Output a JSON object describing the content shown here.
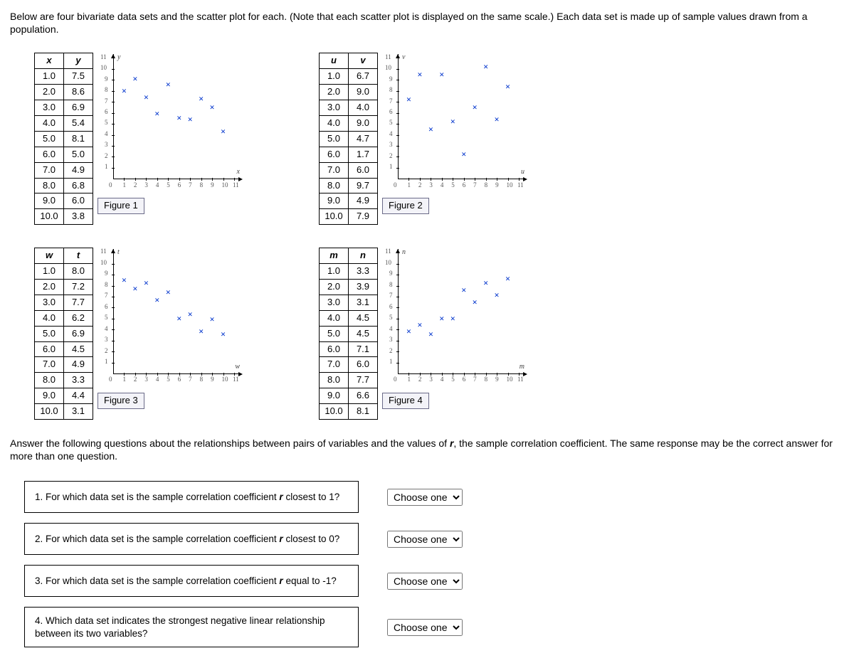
{
  "intro": "Below are four bivariate data sets and the scatter plot for each. (Note that each scatter plot is displayed on the same scale.) Each data set is made up of sample values drawn from a population.",
  "after": "Answer the following questions about the relationships between pairs of variables and the values of r, the sample correlation coefficient. The same response may be the correct answer for more than one question.",
  "after_pre": "Answer the following questions about the relationships between pairs of variables and the values of ",
  "after_r": "r",
  "after_post": ", the sample correlation coefficient. The same response may be the correct answer for more than one question.",
  "figures": [
    {
      "id": "fig1",
      "label": "Figure 1",
      "xh": "x",
      "yh": "y",
      "ax": "x",
      "ay": "y",
      "rows": [
        [
          "1.0",
          "7.5"
        ],
        [
          "2.0",
          "8.6"
        ],
        [
          "3.0",
          "6.9"
        ],
        [
          "4.0",
          "5.4"
        ],
        [
          "5.0",
          "8.1"
        ],
        [
          "6.0",
          "5.0"
        ],
        [
          "7.0",
          "4.9"
        ],
        [
          "8.0",
          "6.8"
        ],
        [
          "9.0",
          "6.0"
        ],
        [
          "10.0",
          "3.8"
        ]
      ]
    },
    {
      "id": "fig2",
      "label": "Figure 2",
      "xh": "u",
      "yh": "v",
      "ax": "u",
      "ay": "v",
      "rows": [
        [
          "1.0",
          "6.7"
        ],
        [
          "2.0",
          "9.0"
        ],
        [
          "3.0",
          "4.0"
        ],
        [
          "4.0",
          "9.0"
        ],
        [
          "5.0",
          "4.7"
        ],
        [
          "6.0",
          "1.7"
        ],
        [
          "7.0",
          "6.0"
        ],
        [
          "8.0",
          "9.7"
        ],
        [
          "9.0",
          "4.9"
        ],
        [
          "10.0",
          "7.9"
        ]
      ]
    },
    {
      "id": "fig3",
      "label": "Figure 3",
      "xh": "w",
      "yh": "t",
      "ax": "w",
      "ay": "t",
      "rows": [
        [
          "1.0",
          "8.0"
        ],
        [
          "2.0",
          "7.2"
        ],
        [
          "3.0",
          "7.7"
        ],
        [
          "4.0",
          "6.2"
        ],
        [
          "5.0",
          "6.9"
        ],
        [
          "6.0",
          "4.5"
        ],
        [
          "7.0",
          "4.9"
        ],
        [
          "8.0",
          "3.3"
        ],
        [
          "9.0",
          "4.4"
        ],
        [
          "10.0",
          "3.1"
        ]
      ]
    },
    {
      "id": "fig4",
      "label": "Figure 4",
      "xh": "m",
      "yh": "n",
      "ax": "m",
      "ay": "n",
      "rows": [
        [
          "1.0",
          "3.3"
        ],
        [
          "2.0",
          "3.9"
        ],
        [
          "3.0",
          "3.1"
        ],
        [
          "4.0",
          "4.5"
        ],
        [
          "5.0",
          "4.5"
        ],
        [
          "6.0",
          "7.1"
        ],
        [
          "7.0",
          "6.0"
        ],
        [
          "8.0",
          "7.7"
        ],
        [
          "9.0",
          "6.6"
        ],
        [
          "10.0",
          "8.1"
        ]
      ]
    }
  ],
  "axis": {
    "min": 0,
    "max": 11,
    "ticks": [
      1,
      2,
      3,
      4,
      5,
      6,
      7,
      8,
      9,
      10,
      11
    ]
  },
  "chart_data": [
    {
      "type": "scatter",
      "title": "Figure 1",
      "xlabel": "x",
      "ylabel": "y",
      "xlim": [
        0,
        11
      ],
      "ylim": [
        0,
        11
      ],
      "x": [
        1,
        2,
        3,
        4,
        5,
        6,
        7,
        8,
        9,
        10
      ],
      "y": [
        7.5,
        8.6,
        6.9,
        5.4,
        8.1,
        5.0,
        4.9,
        6.8,
        6.0,
        3.8
      ]
    },
    {
      "type": "scatter",
      "title": "Figure 2",
      "xlabel": "u",
      "ylabel": "v",
      "xlim": [
        0,
        11
      ],
      "ylim": [
        0,
        11
      ],
      "x": [
        1,
        2,
        3,
        4,
        5,
        6,
        7,
        8,
        9,
        10
      ],
      "y": [
        6.7,
        9.0,
        4.0,
        9.0,
        4.7,
        1.7,
        6.0,
        9.7,
        4.9,
        7.9
      ]
    },
    {
      "type": "scatter",
      "title": "Figure 3",
      "xlabel": "w",
      "ylabel": "t",
      "xlim": [
        0,
        11
      ],
      "ylim": [
        0,
        11
      ],
      "x": [
        1,
        2,
        3,
        4,
        5,
        6,
        7,
        8,
        9,
        10
      ],
      "y": [
        8.0,
        7.2,
        7.7,
        6.2,
        6.9,
        4.5,
        4.9,
        3.3,
        4.4,
        3.1
      ]
    },
    {
      "type": "scatter",
      "title": "Figure 4",
      "xlabel": "m",
      "ylabel": "n",
      "xlim": [
        0,
        11
      ],
      "ylim": [
        0,
        11
      ],
      "x": [
        1,
        2,
        3,
        4,
        5,
        6,
        7,
        8,
        9,
        10
      ],
      "y": [
        3.3,
        3.9,
        3.1,
        4.5,
        4.5,
        7.1,
        6.0,
        7.7,
        6.6,
        8.1
      ]
    }
  ],
  "questions": [
    {
      "text_pre": "1. For which data set is the sample correlation coefficient ",
      "r": "r",
      "text_post": " closest to 1?"
    },
    {
      "text_pre": "2. For which data set is the sample correlation coefficient ",
      "r": "r",
      "text_post": " closest to 0?"
    },
    {
      "text_pre": "3. For which data set is the sample correlation coefficient ",
      "r": "r",
      "text_post": " equal to -1?"
    },
    {
      "text_pre": "4. Which data set indicates the strongest negative linear relationship between its two variables?",
      "r": "",
      "text_post": ""
    }
  ],
  "select_placeholder": "Choose one"
}
